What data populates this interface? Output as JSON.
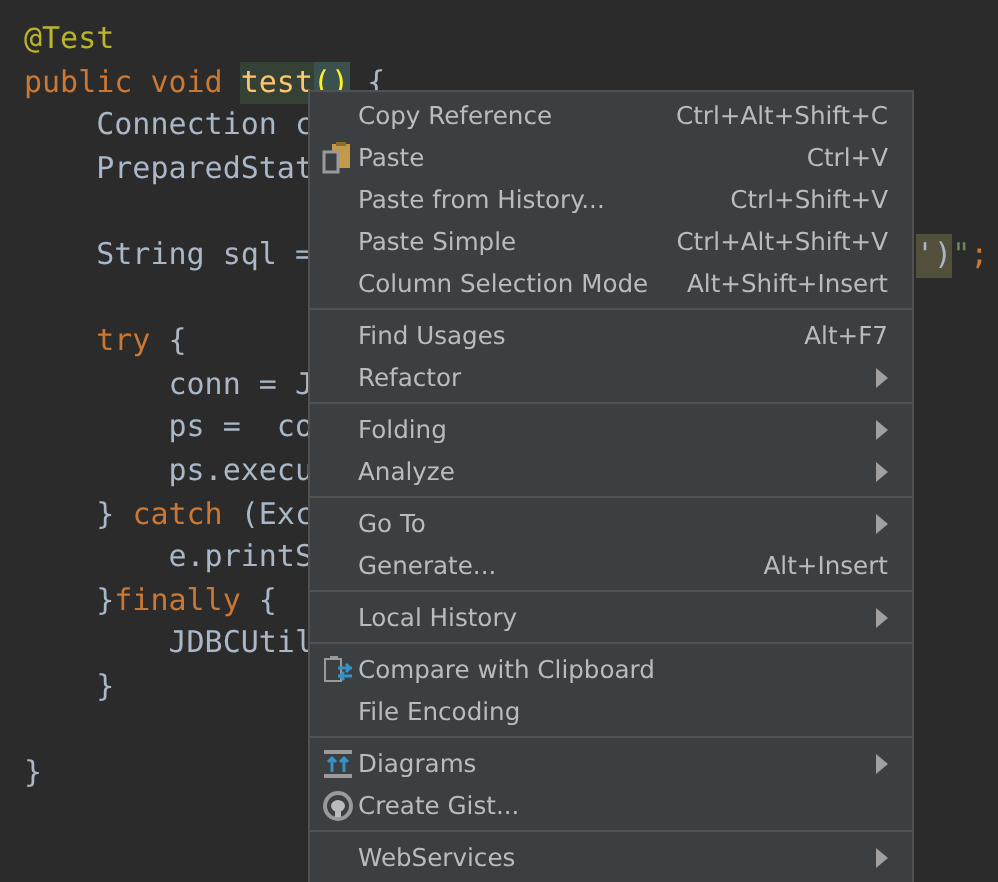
{
  "editor": {
    "lines": [
      {
        "tokens": [
          {
            "kind": "annotation",
            "text": "@Test"
          }
        ]
      },
      {
        "tokens": [
          {
            "kind": "keyword",
            "text": "public void "
          },
          {
            "kind": "method",
            "text": "test"
          },
          {
            "kind": "match",
            "text": "()"
          },
          {
            "kind": "plain",
            "text": " {"
          }
        ]
      },
      {
        "tokens": [
          {
            "kind": "plain",
            "text": "    Connection c"
          }
        ]
      },
      {
        "tokens": [
          {
            "kind": "plain",
            "text": "    PreparedStat"
          }
        ]
      },
      {
        "gap_before": true,
        "tokens": [
          {
            "kind": "plain",
            "text": "    String sql ="
          }
        ],
        "tail": [
          {
            "kind": "stringhl",
            "text": "')"
          },
          {
            "kind": "string",
            "text": "\""
          },
          {
            "kind": "keyword",
            "text": ";"
          }
        ]
      },
      {
        "gap_before": true,
        "tokens": [
          {
            "kind": "keyword",
            "text": "    try"
          },
          {
            "kind": "plain",
            "text": " {"
          }
        ]
      },
      {
        "tokens": [
          {
            "kind": "plain",
            "text": "        conn = J"
          }
        ]
      },
      {
        "tokens": [
          {
            "kind": "plain",
            "text": "        ps =  co"
          }
        ]
      },
      {
        "tokens": [
          {
            "kind": "plain",
            "text": "        ps.execu"
          }
        ]
      },
      {
        "tokens": [
          {
            "kind": "plain",
            "text": "    } "
          },
          {
            "kind": "keyword",
            "text": "catch"
          },
          {
            "kind": "plain",
            "text": " (Exc"
          }
        ]
      },
      {
        "tokens": [
          {
            "kind": "plain",
            "text": "        e.printS"
          }
        ]
      },
      {
        "tokens": [
          {
            "kind": "plain",
            "text": "    }"
          },
          {
            "kind": "keyword",
            "text": "finally"
          },
          {
            "kind": "plain",
            "text": " {"
          }
        ]
      },
      {
        "tokens": [
          {
            "kind": "plain",
            "text": "        JDBCUtil"
          }
        ]
      },
      {
        "tokens": [
          {
            "kind": "plain",
            "text": "    }"
          }
        ]
      },
      {
        "gap_before": true,
        "tokens": [
          {
            "kind": "plain",
            "text": "}"
          }
        ]
      }
    ]
  },
  "context_menu": {
    "groups": [
      [
        {
          "kind": "plain",
          "label": "Copy Reference",
          "shortcut": "Ctrl+Alt+Shift+C",
          "submenu": false
        },
        {
          "kind": "paste",
          "label": "Paste",
          "shortcut": "Ctrl+V",
          "submenu": false
        },
        {
          "kind": "plain",
          "label": "Paste from History...",
          "shortcut": "Ctrl+Shift+V",
          "submenu": false
        },
        {
          "kind": "plain",
          "label": "Paste Simple",
          "shortcut": "Ctrl+Alt+Shift+V",
          "submenu": false
        },
        {
          "kind": "plain",
          "label": "Column Selection Mode",
          "shortcut": "Alt+Shift+Insert",
          "submenu": false
        }
      ],
      [
        {
          "kind": "plain",
          "label": "Find Usages",
          "shortcut": "Alt+F7",
          "submenu": false
        },
        {
          "kind": "plain",
          "label": "Refactor",
          "submenu": true
        }
      ],
      [
        {
          "kind": "plain",
          "label": "Folding",
          "submenu": true
        },
        {
          "kind": "plain",
          "label": "Analyze",
          "submenu": true
        }
      ],
      [
        {
          "kind": "plain",
          "label": "Go To",
          "submenu": true
        },
        {
          "kind": "plain",
          "label": "Generate...",
          "shortcut": "Alt+Insert",
          "submenu": false
        }
      ],
      [
        {
          "kind": "plain",
          "label": "Local History",
          "submenu": true
        }
      ],
      [
        {
          "kind": "compare",
          "label": "Compare with Clipboard",
          "submenu": false
        },
        {
          "kind": "plain",
          "label": "File Encoding",
          "submenu": false
        }
      ],
      [
        {
          "kind": "diagrams",
          "label": "Diagrams",
          "submenu": true
        },
        {
          "kind": "gist",
          "label": "Create Gist...",
          "submenu": false
        }
      ],
      [
        {
          "kind": "plain",
          "label": "WebServices",
          "submenu": true
        }
      ]
    ]
  }
}
